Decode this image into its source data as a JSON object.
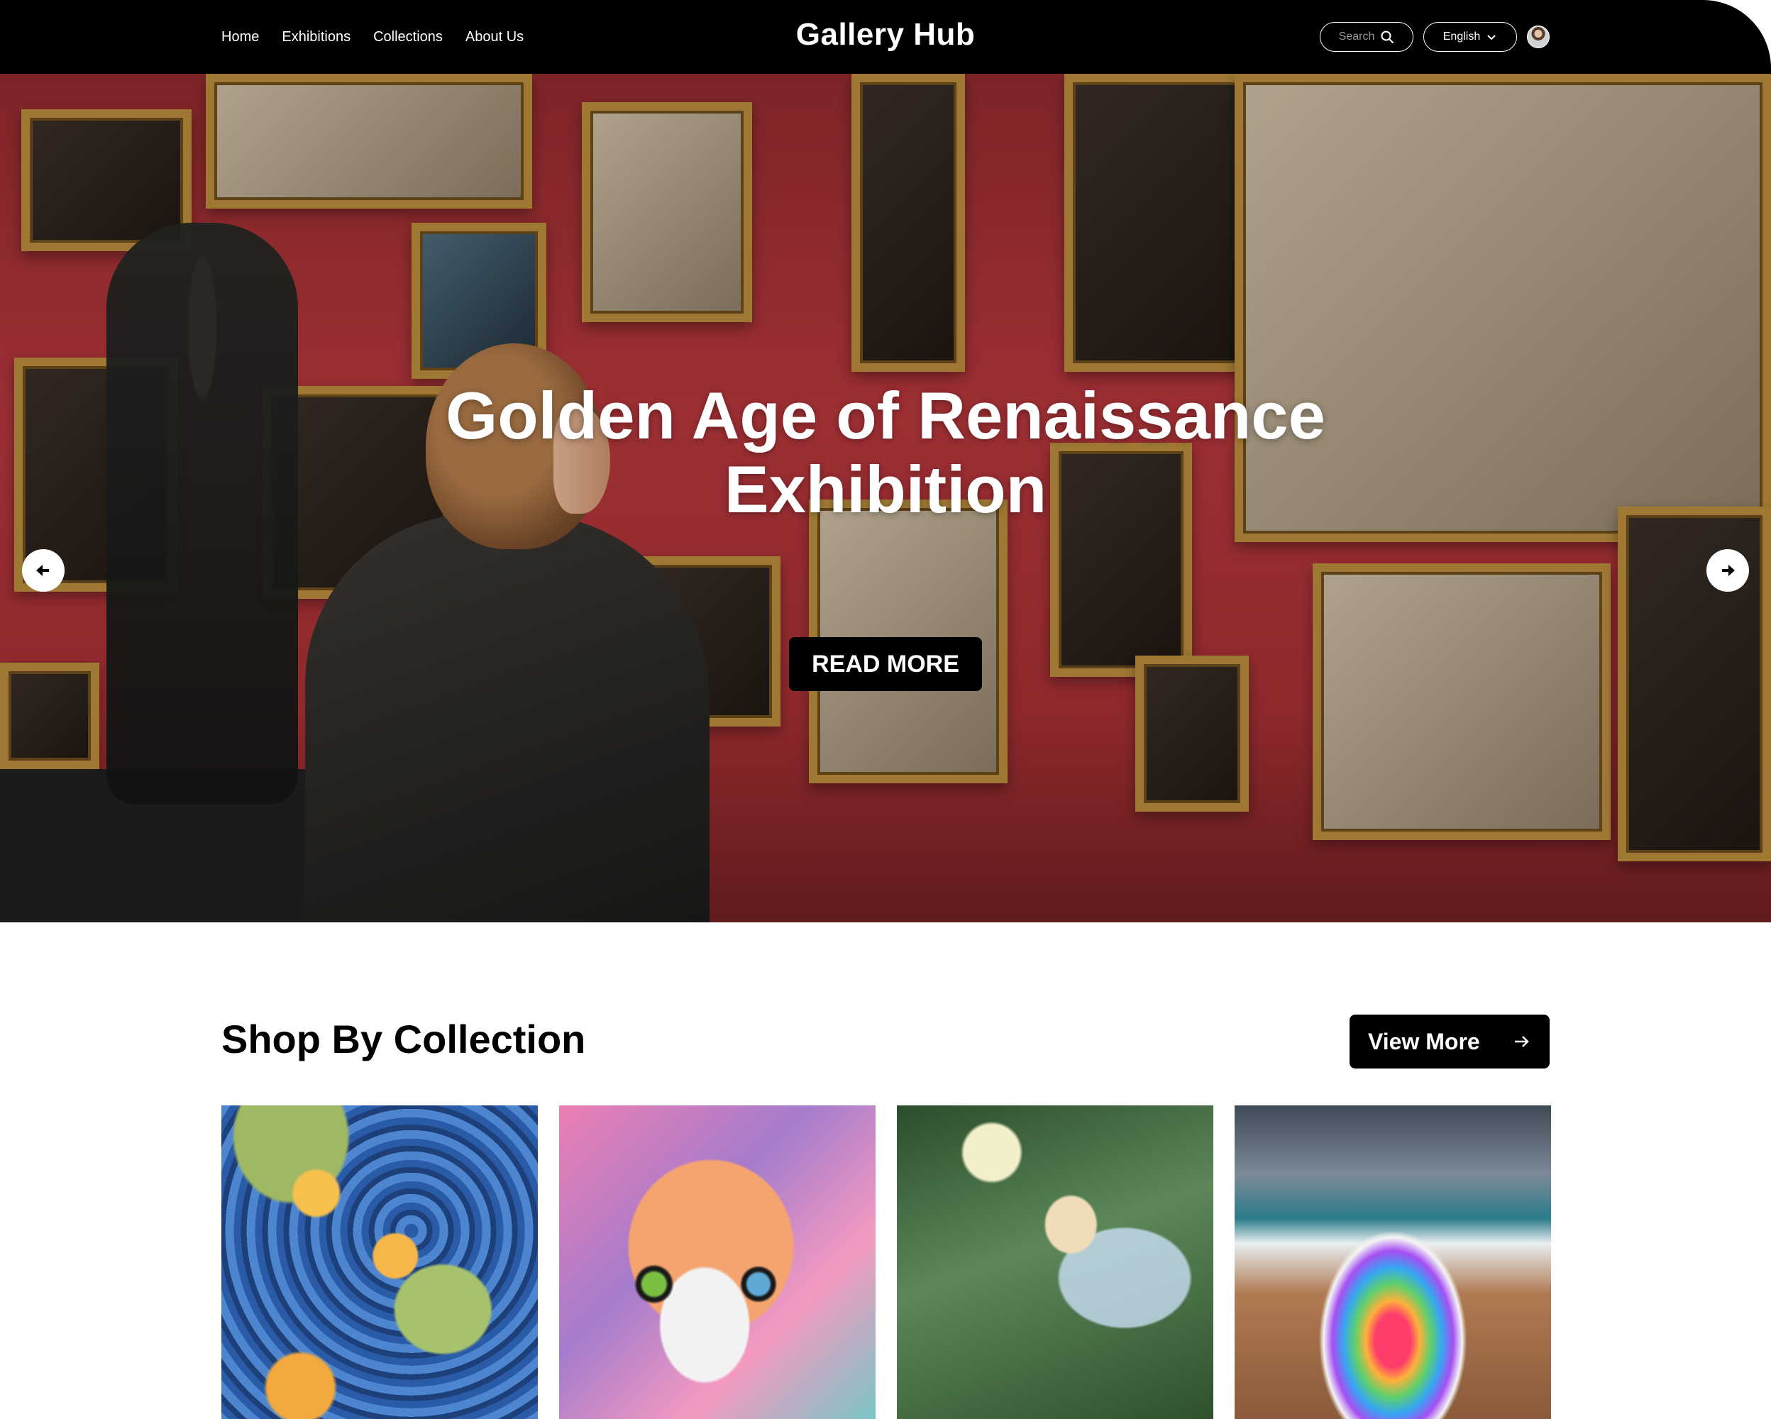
{
  "nav": {
    "links": [
      "Home",
      "Exhibitions",
      "Collections",
      "About Us"
    ],
    "logo": "Gallery Hub",
    "search_placeholder": "Search",
    "language": "English"
  },
  "hero": {
    "title_line1": "Golden Age of Renaissance",
    "title_line2": "Exhibition",
    "cta": "READ MORE",
    "slide_count": 5,
    "active_slide": 4
  },
  "collection": {
    "title": "Shop By Collection",
    "view_more": "View More",
    "cards": [
      {
        "icon": "water-lily-painting"
      },
      {
        "icon": "colorful-cat-painting"
      },
      {
        "icon": "fairy-painting"
      },
      {
        "icon": "rainbow-dress-beach-painting"
      }
    ]
  },
  "colors": {
    "nav_bg": "#000000",
    "accent": "#000000",
    "hero_wall": "#b3363b"
  }
}
